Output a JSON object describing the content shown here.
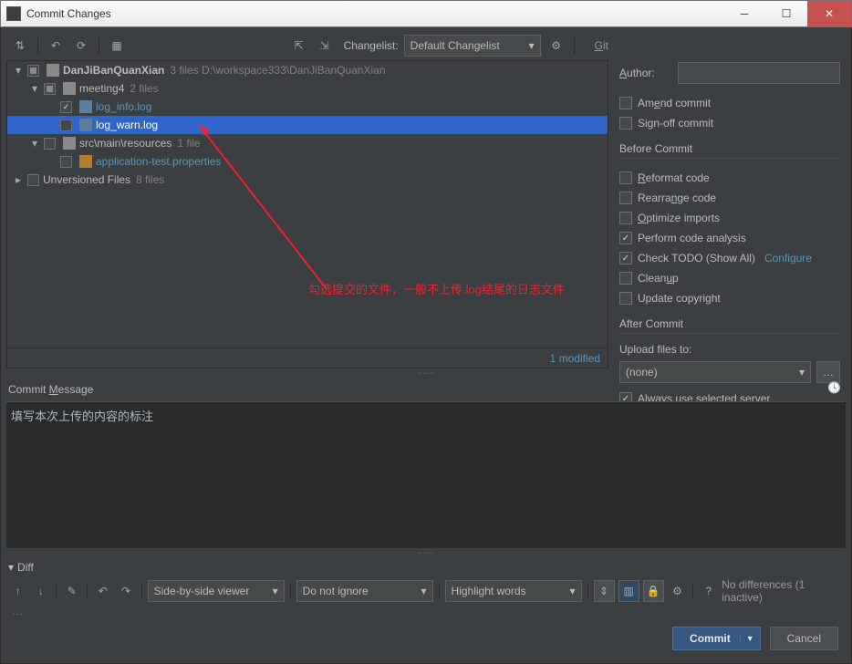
{
  "window": {
    "title": "Commit Changes"
  },
  "toolbar": {
    "changelist_label": "Changelist:",
    "changelist_value": "Default Changelist",
    "git_label": "Git"
  },
  "tree": {
    "root": {
      "name": "DanJiBanQuanXian",
      "meta": "3 files  D:\\workspace333\\DanJiBanQuanXian"
    },
    "meeting4": {
      "name": "meeting4",
      "meta": "2 files"
    },
    "log_info": "log_info.log",
    "log_warn": "log_warn.log",
    "src": {
      "name": "src\\main\\resources",
      "meta": "1 file"
    },
    "apptest": "application-test.properties",
    "unversioned": {
      "name": "Unversioned Files",
      "meta": "8 files"
    },
    "modified": "1 modified"
  },
  "annotation": "勾选提交的文件，一般不上传.log结尾的日志文件",
  "commit_message": {
    "label": "Commit Message",
    "value": "填写本次上传的内容的标注"
  },
  "diff": {
    "label": "Diff",
    "viewer": "Side-by-side viewer",
    "ignore": "Do not ignore",
    "highlight": "Highlight words",
    "nodiff": "No differences (1 inactive)"
  },
  "right": {
    "author_label": "Author:",
    "amend": "Amend commit",
    "signoff": "Sign-off commit",
    "before_title": "Before Commit",
    "reformat": "Reformat code",
    "rearrange": "Rearrange code",
    "optimize": "Optimize imports",
    "analysis": "Perform code analysis",
    "todo": "Check TODO (Show All)",
    "configure": "Configure",
    "cleanup": "Cleanup",
    "copyright": "Update copyright",
    "after_title": "After Commit",
    "upload_label": "Upload files to:",
    "upload_value": "(none)",
    "always_server": "Always use selected server"
  },
  "footer": {
    "commit": "Commit",
    "cancel": "Cancel"
  }
}
